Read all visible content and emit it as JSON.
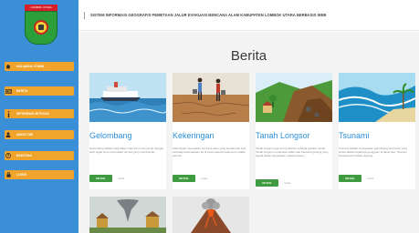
{
  "sidebar": {
    "logo_banner": "LOMBOK UTARA",
    "items": [
      {
        "label": "HALAMAN UTAMA",
        "icon": "home-icon"
      },
      {
        "label": "BERITA",
        "icon": "newspaper-icon"
      },
      {
        "label": "INFORMASI MITIGASI",
        "icon": "info-icon"
      },
      {
        "label": "ABOUT ME",
        "icon": "user-icon"
      },
      {
        "label": "BANTUAN",
        "icon": "help-icon"
      },
      {
        "label": "LOGIN",
        "icon": "lock-icon"
      }
    ],
    "menu_color": "#f0a42c",
    "bg_color": "#3a8fd6"
  },
  "header": {
    "title": "SISTEM INFORMASI GEOGRAFIS PEMETAAN JALUR EVAKUASI BENCANA ALAM KABUPATEN LOMBOK UTARA BERBASIS WEB"
  },
  "main": {
    "page_title": "Berita",
    "cards": [
      {
        "title": "Gelombang",
        "desc": "Gelombang adalah pergerakan naik dan turunnya air dengan arah tegak lurus permukaan air laut yang membentuk...",
        "button": "DETAIL",
        "note": "...views"
      },
      {
        "title": "Kekeringan",
        "desc": "Kekeringan merupakan bencana alam yang berdampak luas terhadap ketersediaan air di suatu daerah pada kurun waktu tertentu...",
        "button": "DETAIL",
        "note": "...views"
      },
      {
        "title": "Tanah Longsor",
        "desc": "Tanah longsor juga sering disebut sebagai gerakan tanah. Tanah longsor merupakan salah satu bencana geologi yang terjadi akibat pergerakan massa batuan...",
        "button": "DETAIL",
        "note": "...views"
      },
      {
        "title": "Tsunami",
        "desc": "Tsunami adalah serangkaian gelombang laut besar yang timbul akibat terjadinya gangguan di dasar laut. Tsunami berasal dari bahasa Jepang...",
        "button": "DETAIL",
        "note": "...views"
      }
    ],
    "accent_color": "#2e8fd8",
    "button_color": "#3f9b3f"
  }
}
